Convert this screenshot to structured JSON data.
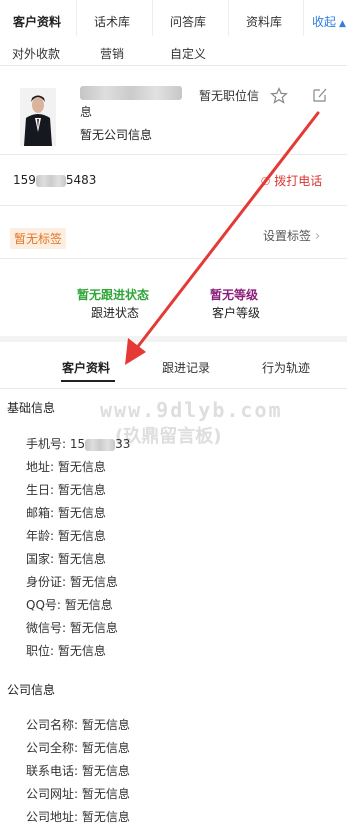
{
  "top_tabs": [
    "客户资料",
    "话术库",
    "问答库",
    "资料库"
  ],
  "collapse_label": "收起",
  "top_tabs_row2": [
    "对外收款",
    "营销",
    "自定义"
  ],
  "profile": {
    "position": "暂无职位信",
    "position_cont": "息",
    "company": "暂无公司信息",
    "phone_prefix": "159",
    "phone_suffix": "5483",
    "call_label": "拨打电话",
    "tag": "暂无标签",
    "set_tag_label": "设置标签"
  },
  "status": {
    "follow_value": "暂无跟进状态",
    "follow_label": "跟进状态",
    "level_value": "暂无等级",
    "level_label": "客户等级"
  },
  "detail_tabs": [
    "客户资料",
    "跟进记录",
    "行为轨迹"
  ],
  "watermark": {
    "line1": "www.9dlyb.com",
    "line2": "(玖鼎留言板)"
  },
  "basic_info": {
    "title": "基础信息",
    "phone_label": "手机号: 15",
    "phone_tail": "33",
    "fields": [
      "地址: 暂无信息",
      "生日: 暂无信息",
      "邮箱: 暂无信息",
      "年龄: 暂无信息",
      "国家: 暂无信息",
      "身份证: 暂无信息",
      "QQ号: 暂无信息",
      "微信号: 暂无信息",
      "职位: 暂无信息"
    ]
  },
  "company_info": {
    "title": "公司信息",
    "fields": [
      "公司名称: 暂无信息",
      "公司全称: 暂无信息",
      "联系电话: 暂无信息",
      "公司网址: 暂无信息",
      "公司地址: 暂无信息"
    ]
  },
  "colors": {
    "link_blue": "#2f7de1",
    "call_red": "#d8372f",
    "status_green": "#30a537",
    "level_purple": "#8b1f7a",
    "tag_orange": "#e37521",
    "arrow_red": "#e53935"
  }
}
